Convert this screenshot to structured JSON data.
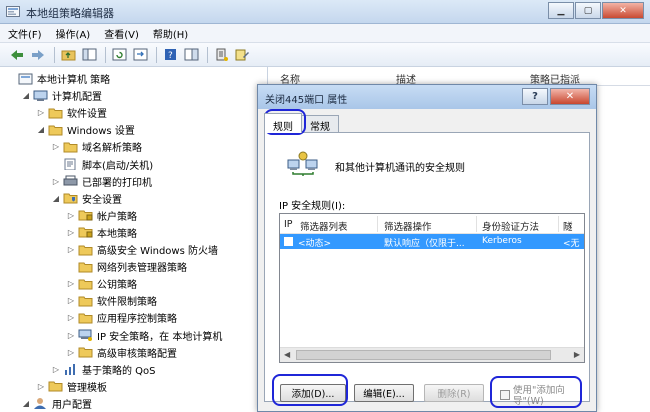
{
  "window": {
    "title": "本地组策略编辑器"
  },
  "menu": [
    "文件(F)",
    "操作(A)",
    "查看(V)",
    "帮助(H)"
  ],
  "tree": [
    {
      "label": "本地计算机 策略",
      "indent": 0,
      "exp": "",
      "icon": "computer-policy-icon"
    },
    {
      "label": "计算机配置",
      "indent": 1,
      "exp": "◢",
      "icon": "computer-icon"
    },
    {
      "label": "软件设置",
      "indent": 2,
      "exp": "▷",
      "icon": "folder-icon"
    },
    {
      "label": "Windows 设置",
      "indent": 2,
      "exp": "◢",
      "icon": "folder-icon"
    },
    {
      "label": "域名解析策略",
      "indent": 3,
      "exp": "▷",
      "icon": "folder-icon"
    },
    {
      "label": "脚本(启动/关机)",
      "indent": 3,
      "exp": "",
      "icon": "script-icon"
    },
    {
      "label": "已部署的打印机",
      "indent": 3,
      "exp": "▷",
      "icon": "printer-icon"
    },
    {
      "label": "安全设置",
      "indent": 3,
      "exp": "◢",
      "icon": "security-icon"
    },
    {
      "label": "帐户策略",
      "indent": 4,
      "exp": "▷",
      "icon": "folder-lock-icon"
    },
    {
      "label": "本地策略",
      "indent": 4,
      "exp": "▷",
      "icon": "folder-lock-icon"
    },
    {
      "label": "高级安全 Windows 防火墙",
      "indent": 4,
      "exp": "▷",
      "icon": "folder-icon"
    },
    {
      "label": "网络列表管理器策略",
      "indent": 4,
      "exp": "",
      "icon": "folder-icon"
    },
    {
      "label": "公钥策略",
      "indent": 4,
      "exp": "▷",
      "icon": "folder-icon"
    },
    {
      "label": "软件限制策略",
      "indent": 4,
      "exp": "▷",
      "icon": "folder-icon"
    },
    {
      "label": "应用程序控制策略",
      "indent": 4,
      "exp": "▷",
      "icon": "folder-icon"
    },
    {
      "label": "IP 安全策略，在 本地计算机",
      "indent": 4,
      "exp": "▷",
      "icon": "ip-security-icon"
    },
    {
      "label": "高级审核策略配置",
      "indent": 4,
      "exp": "▷",
      "icon": "folder-icon"
    },
    {
      "label": "基于策略的 QoS",
      "indent": 3,
      "exp": "▷",
      "icon": "qos-chart-icon"
    },
    {
      "label": "管理模板",
      "indent": 2,
      "exp": "▷",
      "icon": "folder-icon"
    },
    {
      "label": "用户配置",
      "indent": 1,
      "exp": "◢",
      "icon": "user-icon"
    }
  ],
  "list_header": {
    "name": "名称",
    "desc": "描述",
    "assigned": "策略已指派"
  },
  "dialog": {
    "title": "关闭445端口 属性",
    "help": "?",
    "close": "✕",
    "tabs": [
      "规则",
      "常规"
    ],
    "desc": "和其他计算机通讯的安全规则",
    "rules_label": "IP 安全规则(I):",
    "columns": [
      "IP",
      "筛选器列表",
      "筛选器操作",
      "身份验证方法",
      "隧"
    ],
    "row": [
      "<动态>",
      "默认响应（仅限于...",
      "Kerberos",
      "<无"
    ],
    "buttons": {
      "add": "添加(D)...",
      "edit": "编辑(E)...",
      "delete": "删除(R)"
    },
    "wizard_label": "使用\"添加向导\"(W)"
  }
}
